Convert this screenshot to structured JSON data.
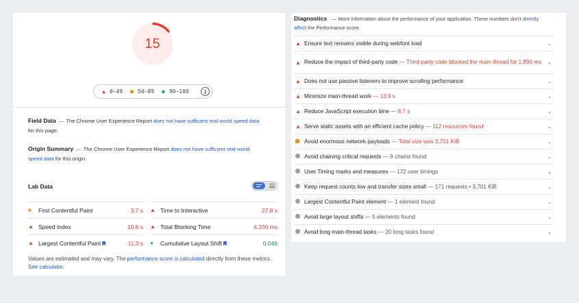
{
  "score": {
    "value": "15",
    "fraction": 0.15,
    "color": "#e23b2e"
  },
  "legend": {
    "items": [
      {
        "symbol": "▲",
        "range": "0–49",
        "color": "#e23b2e"
      },
      {
        "symbol": "■",
        "range": "50–89",
        "color": "#f0932b"
      },
      {
        "symbol": "●",
        "range": "90–100",
        "color": "#35a853"
      }
    ],
    "info_icon": "i"
  },
  "field_data": {
    "title": "Field Data",
    "dash": "—",
    "text_before": "The Chrome User Experience Report ",
    "link": "does not have sufficient real-world speed data",
    "text_after": " for this page."
  },
  "origin_summary": {
    "title": "Origin Summary",
    "dash": "—",
    "text_before": "The Chrome User Experience Report ",
    "link": "does not have sufficient real-world speed data",
    "text_after": " for this origin."
  },
  "lab_data": {
    "title": "Lab Data",
    "metrics": [
      {
        "label": "First Contentful Paint",
        "value": "3.7 s",
        "status": "orange"
      },
      {
        "label": "Time to Interactive",
        "value": "27.8 s",
        "status": "red"
      },
      {
        "label": "Speed Index",
        "value": "10.6 s",
        "status": "red"
      },
      {
        "label": "Total Blocking Time",
        "value": "4,330 ms",
        "status": "red"
      },
      {
        "label": "Largest Contentful Paint",
        "value": "11.3 s",
        "status": "red",
        "bookmark": true
      },
      {
        "label": "Cumulative Layout Shift",
        "value": "0.046",
        "status": "green",
        "bookmark": true
      }
    ]
  },
  "footnote": {
    "text_before": "Values are estimated and may vary. The ",
    "link1": "performance score is calculated",
    "text_mid": " directly from these metrics. ",
    "link2": "See calculator."
  },
  "diagnostics": {
    "title": "Diagnostics",
    "dash": "—",
    "text_before": "More information about the performance of your application. These numbers don't ",
    "link": "directly affect",
    "text_after": " the Performance score.",
    "audits": [
      {
        "title": "Ensure text remains visible during webfont load",
        "detail": "",
        "status": "red"
      },
      {
        "title": "Reduce the impact of third-party code",
        "detail": "Third-party code blocked the main thread for 1,890 ms",
        "status": "red"
      },
      {
        "title": "Does not use passive listeners to improve scrolling performance",
        "detail": "",
        "status": "red"
      },
      {
        "title": "Minimize main-thread work",
        "detail": "13.9 s",
        "status": "red"
      },
      {
        "title": "Reduce JavaScript execution time",
        "detail": "8.7 s",
        "status": "red"
      },
      {
        "title": "Serve static assets with an efficient cache policy",
        "detail": "112 resources found",
        "status": "red"
      },
      {
        "title": "Avoid enormous network payloads",
        "detail": "Total size was 3,701 KiB",
        "status": "orange"
      },
      {
        "title": "Avoid chaining critical requests",
        "detail": "9 chains found",
        "status": "gray"
      },
      {
        "title": "User Timing marks and measures",
        "detail": "172 user timings",
        "status": "gray"
      },
      {
        "title": "Keep request counts low and transfer sizes small",
        "detail": "171 requests • 3,701 KiB",
        "status": "gray"
      },
      {
        "title": "Largest Contentful Paint element",
        "detail": "1 element found",
        "status": "gray"
      },
      {
        "title": "Avoid large layout shifts",
        "detail": "5 elements found",
        "status": "gray"
      },
      {
        "title": "Avoid long main-thread tasks",
        "detail": "20 long tasks found",
        "status": "gray"
      }
    ]
  },
  "colors": {
    "fail": "#e23b2e",
    "average": "#f0932b",
    "pass": "#35a853",
    "link": "#1a57d0"
  }
}
